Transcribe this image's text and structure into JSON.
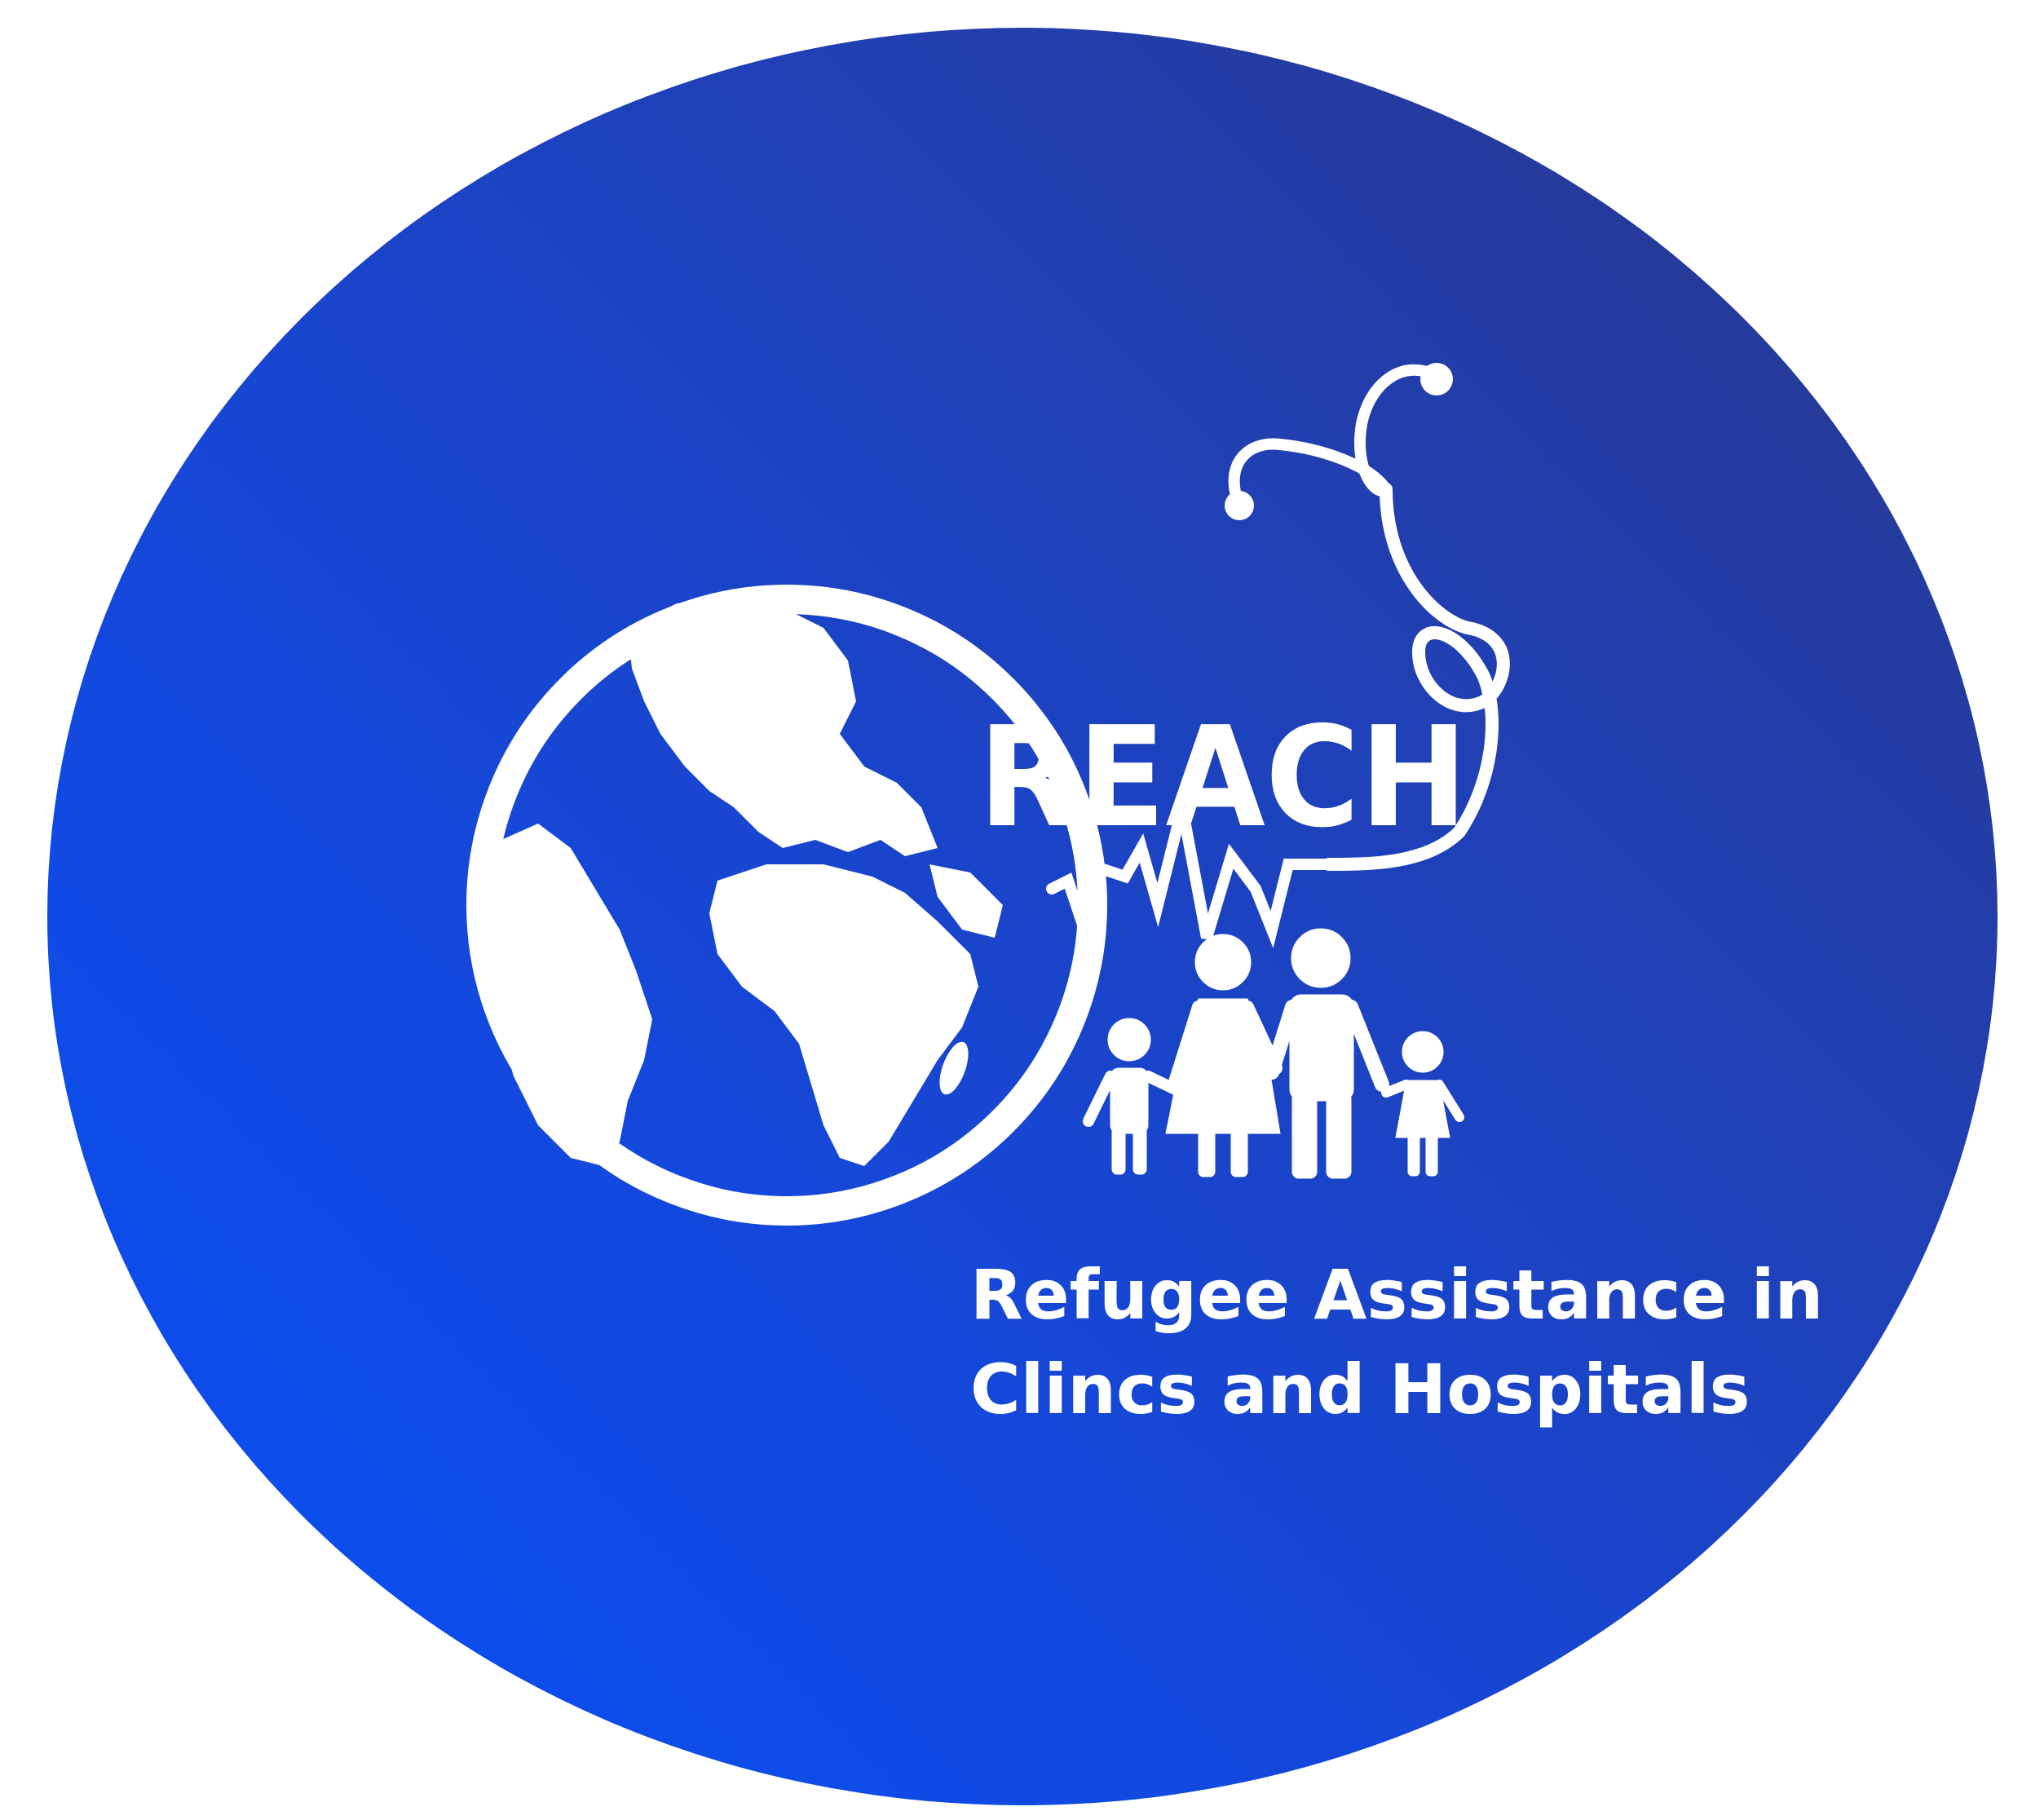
{
  "logo": {
    "wordmark": "REACH",
    "tagline_line1": "Refugee Assistance in",
    "tagline_line2": "Clincs and Hospitals"
  },
  "colors": {
    "background": "#ffffff",
    "circle_gradient_start": "#0750f6",
    "circle_gradient_end": "#293788",
    "foreground": "#ffffff"
  },
  "icons": [
    "globe-icon",
    "stethoscope-icon",
    "heartbeat-line-icon",
    "family-icon"
  ]
}
